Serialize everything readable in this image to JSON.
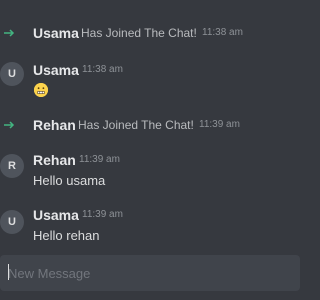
{
  "events": [
    {
      "type": "join",
      "user": "Usama",
      "text": "Has Joined The Chat!",
      "time": "11:38 am"
    },
    {
      "type": "message",
      "avatar": "U",
      "author": "Usama",
      "time": "11:38 am",
      "emoji": "grimacing-face"
    },
    {
      "type": "join",
      "user": "Rehan",
      "text": "Has Joined The Chat!",
      "time": "11:39 am"
    },
    {
      "type": "message",
      "avatar": "R",
      "author": "Rehan",
      "time": "11:39 am",
      "text": "Hello usama"
    },
    {
      "type": "message",
      "avatar": "U",
      "author": "Usama",
      "time": "11:39 am",
      "text": "Hello rehan"
    }
  ],
  "composer": {
    "placeholder": "New Message",
    "value": ""
  },
  "colors": {
    "background": "#36393f",
    "composer": "#40444b",
    "join_arrow": "#43b581",
    "avatar": "#4f545c"
  }
}
